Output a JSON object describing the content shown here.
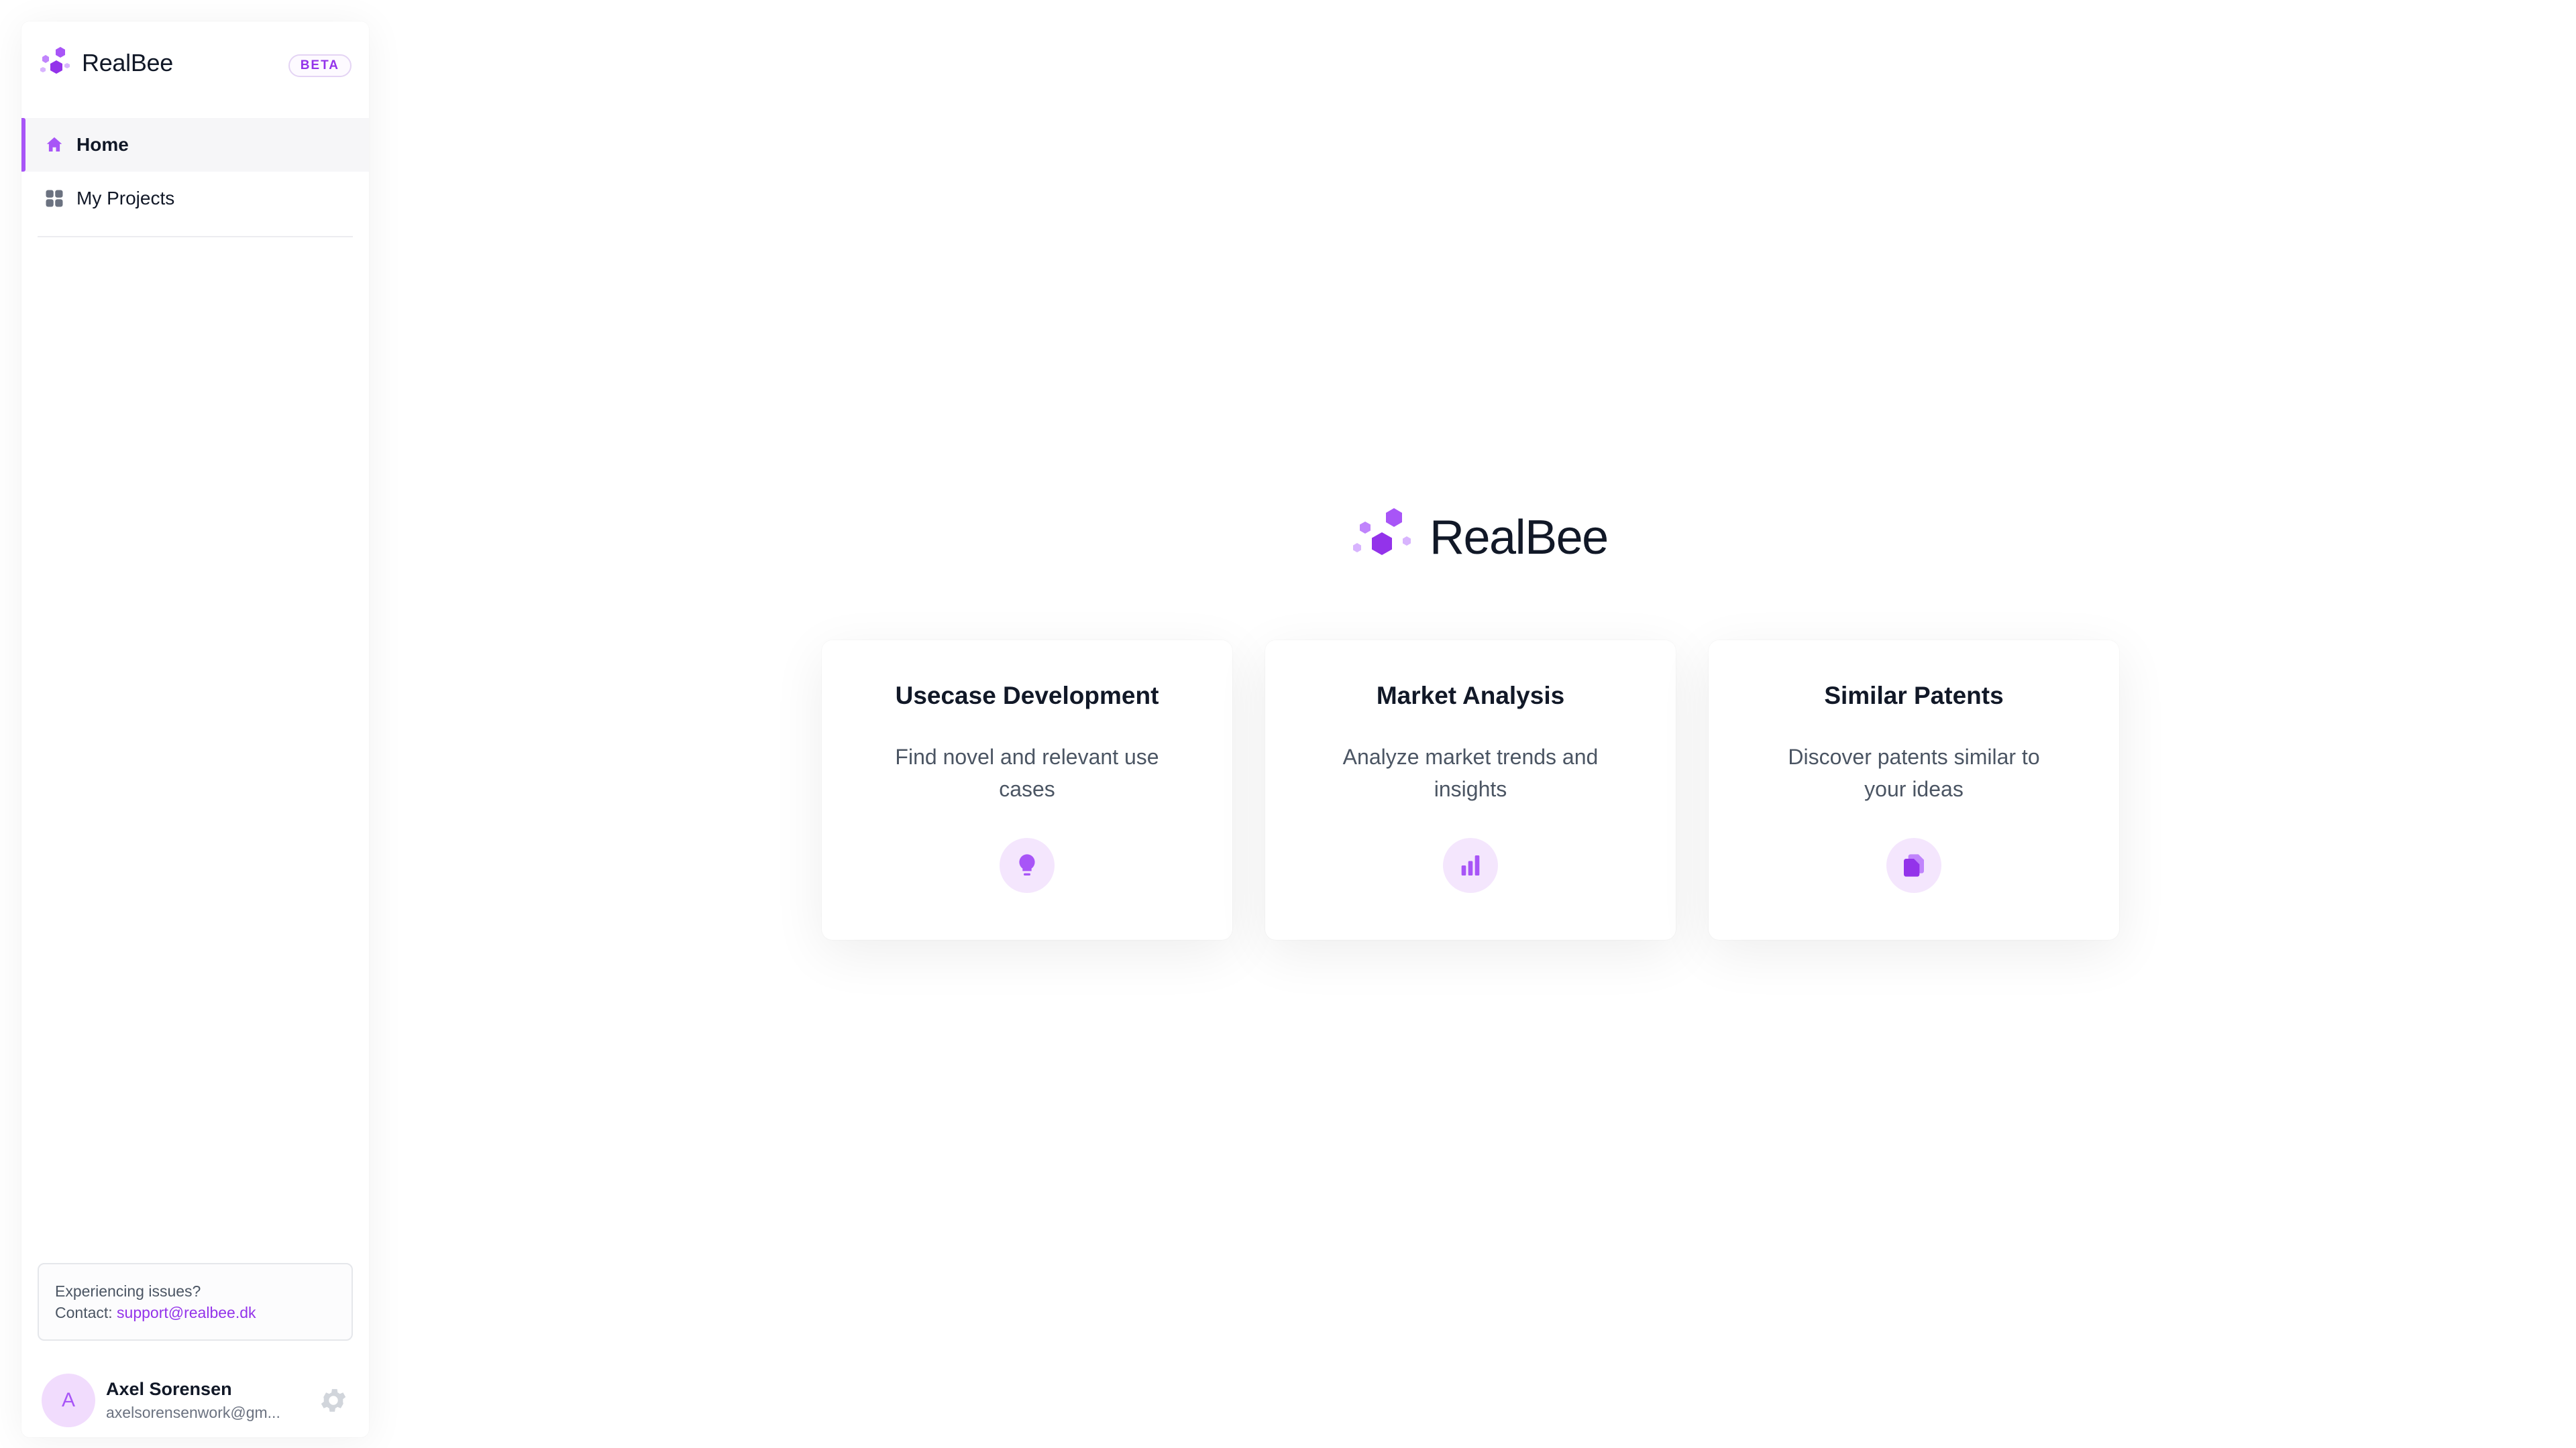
{
  "sidebar": {
    "brand": "RealBee",
    "badge": "BETA",
    "nav": [
      {
        "label": "Home",
        "icon": "home-icon",
        "active": true
      },
      {
        "label": "My Projects",
        "icon": "grid-icon",
        "active": false
      }
    ],
    "support": {
      "line1": "Experiencing issues?",
      "contact_prefix": "Contact: ",
      "email": "support@realbee.dk"
    },
    "user": {
      "initial": "A",
      "name": "Axel Sorensen",
      "email": "axelsorensenwork@gm..."
    }
  },
  "main": {
    "logo_text": "RealBee",
    "cards": [
      {
        "title": "Usecase Development",
        "description": "Find novel and relevant use cases",
        "icon": "lightbulb-icon"
      },
      {
        "title": "Market Analysis",
        "description": "Analyze market trends and insights",
        "icon": "bar-chart-icon"
      },
      {
        "title": "Similar Patents",
        "description": "Discover patents similar to your ideas",
        "icon": "documents-icon"
      }
    ]
  },
  "colors": {
    "accent": "#a855f7",
    "accent_dark": "#9333ea",
    "icon_bg": "#f4e6fd"
  }
}
